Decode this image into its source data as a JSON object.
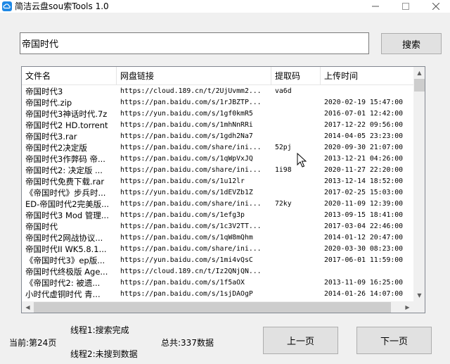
{
  "window": {
    "title": "简洁云盘sou索Tools 1.0",
    "icon": "cloud-app-icon"
  },
  "search": {
    "value": "帝国时代",
    "button_label": "搜索"
  },
  "table": {
    "columns": [
      "文件名",
      "网盘链接",
      "提取码",
      "上传时间"
    ],
    "rows": [
      {
        "name": "帝国时代3",
        "link": "https://cloud.189.cn/t/2UjUvmm2...",
        "code": "va6d",
        "time": ""
      },
      {
        "name": "帝国时代.zip",
        "link": "https://pan.baidu.com/s/1rJBZTP...",
        "code": "",
        "time": "2020-02-19 15:47:00"
      },
      {
        "name": "帝国时代3神话时代.7z",
        "link": "https://yun.baidu.com/s/1gf0kmR5",
        "code": "",
        "time": "2016-07-01 12:42:00"
      },
      {
        "name": "帝国时代2 HD.torrent",
        "link": "https://pan.baidu.com/s/1mhNnRRi",
        "code": "",
        "time": "2017-12-22 09:56:00"
      },
      {
        "name": "帝国时代3.rar",
        "link": "https://pan.baidu.com/s/1gdh2Na7",
        "code": "",
        "time": "2014-04-05 23:23:00"
      },
      {
        "name": "帝国时代2决定版",
        "link": "https://pan.baidu.com/share/ini...",
        "code": "52pj",
        "time": "2020-09-30 21:07:00"
      },
      {
        "name": "帝国时代3作弊码 帝...",
        "link": "https://pan.baidu.com/s/1qWpVxJQ",
        "code": "",
        "time": "2013-12-21 04:26:00"
      },
      {
        "name": "帝国时代2: 决定版 ...",
        "link": "https://pan.baidu.com/share/ini...",
        "code": "1i98",
        "time": "2020-11-27 22:20:00"
      },
      {
        "name": "帝国时代免费下载.rar",
        "link": "https://pan.baidu.com/s/1u12lr",
        "code": "",
        "time": "2013-12-14 18:52:00"
      },
      {
        "name": "《帝国时代》步兵时...",
        "link": "https://yun.baidu.com/s/1dEVZb1Z",
        "code": "",
        "time": "2017-02-25 15:03:00"
      },
      {
        "name": "ED-帝国时代2完美版...",
        "link": "https://pan.baidu.com/share/ini...",
        "code": "72ky",
        "time": "2020-11-09 12:39:00"
      },
      {
        "name": "帝国时代3 Mod 管理...",
        "link": "https://pan.baidu.com/s/1efg3p",
        "code": "",
        "time": "2013-09-15 18:41:00"
      },
      {
        "name": "帝国时代",
        "link": "https://pan.baidu.com/s/1c3V2TT...",
        "code": "",
        "time": "2017-03-04 22:46:00"
      },
      {
        "name": "帝国时代2网战协议...",
        "link": "https://pan.baidu.com/s/1qW8mQhm",
        "code": "",
        "time": "2014-01-12 20:47:00"
      },
      {
        "name": "帝国时代II WK5.8.1...",
        "link": "https://pan.baidu.com/share/ini...",
        "code": "",
        "time": "2020-03-30 08:23:00"
      },
      {
        "name": "《帝国时代3》ep版...",
        "link": "https://yun.baidu.com/s/1mi4vQsC",
        "code": "",
        "time": "2017-06-01 11:59:00"
      },
      {
        "name": "帝国时代终极版 Age...",
        "link": "https://cloud.189.cn/t/Iz2QNjQN...",
        "code": "",
        "time": ""
      },
      {
        "name": "《帝国时代2: 被遗...",
        "link": "https://pan.baidu.com/s/1f5aOX",
        "code": "",
        "time": "2013-11-09 16:25:00"
      },
      {
        "name": "小时代虚铜时代 青...",
        "link": "https://pan.baidu.com/s/1sjDAOgP",
        "code": "",
        "time": "2014-01-26 14:07:00"
      }
    ]
  },
  "status": {
    "current_page": "当前:第24页",
    "thread1": "线程1:搜索完成",
    "thread2": "线程2:未搜到数据",
    "total": "总共:337数据"
  },
  "nav": {
    "prev_label": "上一页",
    "next_label": "下一页"
  },
  "colors": {
    "window_bg": "#f0f0f0",
    "button_bg": "#e1e1e1",
    "titlebar_bg": "#ffffff",
    "app_icon": "#1e88e5"
  }
}
